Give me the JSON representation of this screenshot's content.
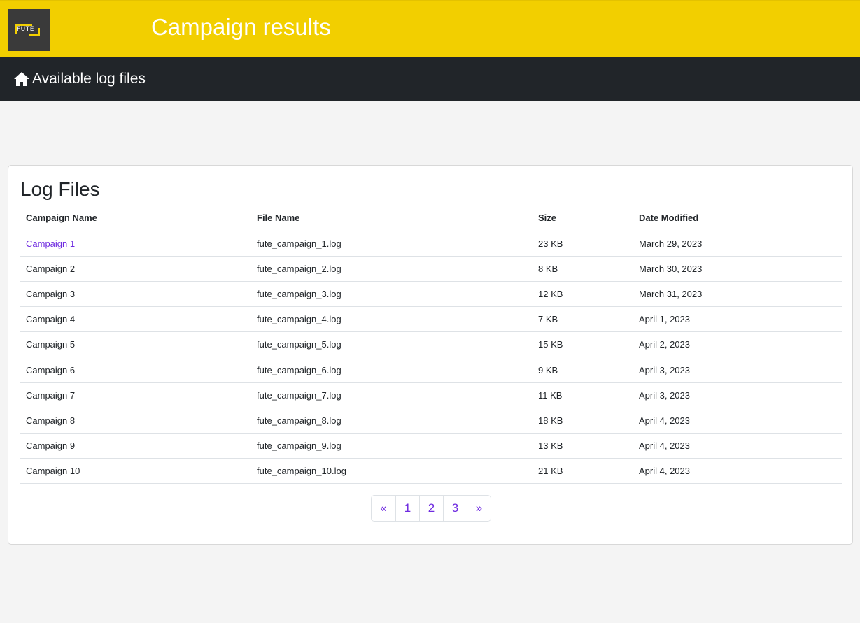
{
  "header": {
    "logo_text": "FUTE",
    "title": "Campaign results"
  },
  "nav": {
    "link_label": "Available log files",
    "icon": "home-icon"
  },
  "card": {
    "title": "Log Files"
  },
  "table": {
    "columns": [
      "Campaign Name",
      "File Name",
      "Size",
      "Date Modified"
    ],
    "rows": [
      {
        "campaign": "Campaign 1",
        "file": "fute_campaign_1.log",
        "size": "23 KB",
        "date": "March 29, 2023",
        "linked": true
      },
      {
        "campaign": "Campaign 2",
        "file": "fute_campaign_2.log",
        "size": "8 KB",
        "date": "March 30, 2023",
        "linked": false
      },
      {
        "campaign": "Campaign 3",
        "file": "fute_campaign_3.log",
        "size": "12 KB",
        "date": "March 31, 2023",
        "linked": false
      },
      {
        "campaign": "Campaign 4",
        "file": "fute_campaign_4.log",
        "size": "7 KB",
        "date": "April 1, 2023",
        "linked": false
      },
      {
        "campaign": "Campaign 5",
        "file": "fute_campaign_5.log",
        "size": "15 KB",
        "date": "April 2, 2023",
        "linked": false
      },
      {
        "campaign": "Campaign 6",
        "file": "fute_campaign_6.log",
        "size": "9 KB",
        "date": "April 3, 2023",
        "linked": false
      },
      {
        "campaign": "Campaign 7",
        "file": "fute_campaign_7.log",
        "size": "11 KB",
        "date": "April 3, 2023",
        "linked": false
      },
      {
        "campaign": "Campaign 8",
        "file": "fute_campaign_8.log",
        "size": "18 KB",
        "date": "April 4, 2023",
        "linked": false
      },
      {
        "campaign": "Campaign 9",
        "file": "fute_campaign_9.log",
        "size": "13 KB",
        "date": "April 4, 2023",
        "linked": false
      },
      {
        "campaign": "Campaign 10",
        "file": "fute_campaign_10.log",
        "size": "21 KB",
        "date": "April 4, 2023",
        "linked": false
      }
    ]
  },
  "pagination": {
    "prev": "«",
    "pages": [
      "1",
      "2",
      "3"
    ],
    "next": "»"
  },
  "colors": {
    "header_bg": "#f2cf00",
    "nav_bg": "#212529",
    "link": "#6f2be0",
    "page_bg": "#f4f4f4"
  }
}
